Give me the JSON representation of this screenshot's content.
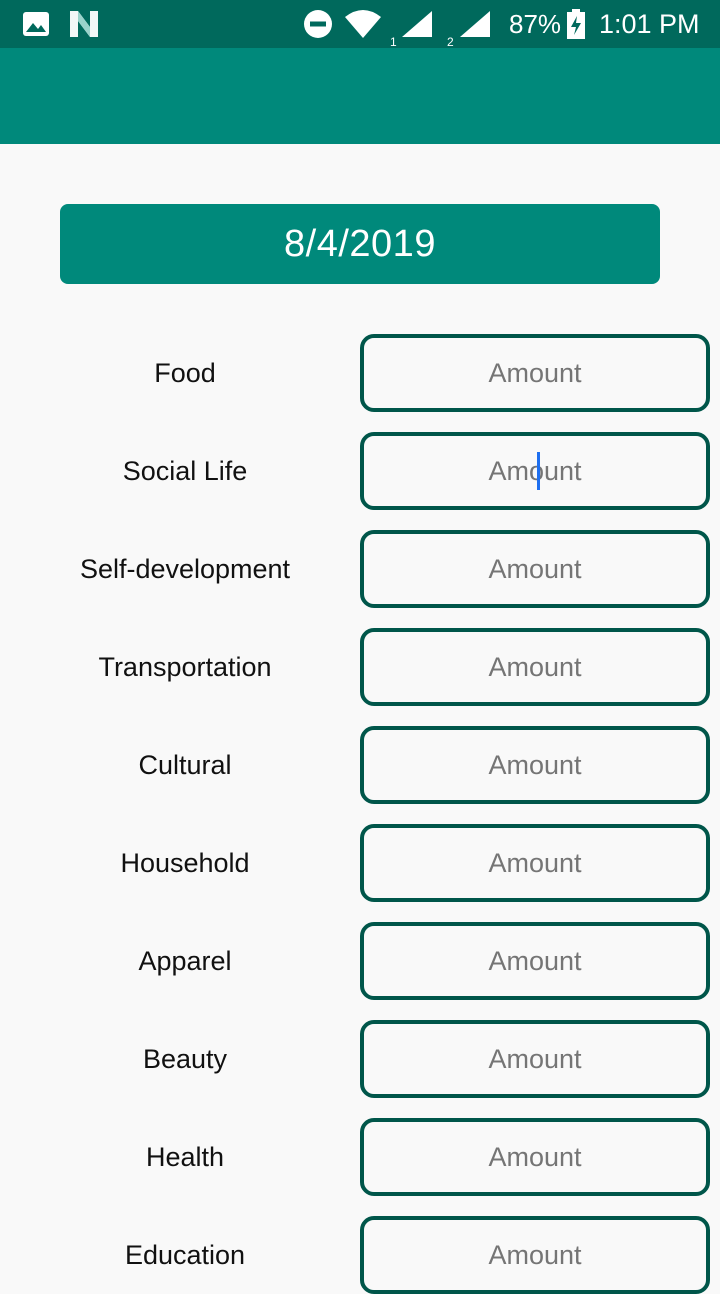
{
  "status_bar": {
    "sim1_label": "1",
    "sim2_label": "2",
    "battery": "87%",
    "time": "1:01 PM",
    "icons": [
      "image-icon",
      "n-notification-icon",
      "do-not-disturb-icon",
      "wifi-icon",
      "signal-sim1-icon",
      "signal-sim2-icon",
      "battery-charging-icon"
    ]
  },
  "colors": {
    "status_bar": "#00695c",
    "app_bar": "#00897b",
    "field_border": "#00564a",
    "background": "#f9f9f9"
  },
  "date_button": {
    "label": "8/4/2019"
  },
  "categories": [
    {
      "label": "Food",
      "placeholder": "Amount"
    },
    {
      "label": "Social Life",
      "placeholder": "Amount"
    },
    {
      "label": "Self-development",
      "placeholder": "Amount"
    },
    {
      "label": "Transportation",
      "placeholder": "Amount"
    },
    {
      "label": "Cultural",
      "placeholder": "Amount"
    },
    {
      "label": "Household",
      "placeholder": "Amount"
    },
    {
      "label": "Apparel",
      "placeholder": "Amount"
    },
    {
      "label": "Beauty",
      "placeholder": "Amount"
    },
    {
      "label": "Health",
      "placeholder": "Amount"
    },
    {
      "label": "Education",
      "placeholder": "Amount"
    }
  ]
}
